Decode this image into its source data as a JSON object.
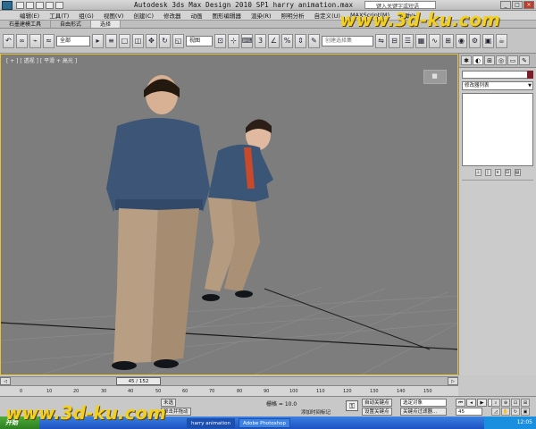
{
  "titlebar": {
    "title": "Autodesk 3ds Max Design 2010 SP1    harry animation.max",
    "search_placeholder": "键入关键字或短语"
  },
  "menubar": {
    "items": [
      "编辑(E)",
      "工具(T)",
      "组(G)",
      "视图(V)",
      "创建(C)",
      "修改器",
      "动画",
      "图形编辑器",
      "渲染(R)",
      "照明分析",
      "自定义(U)",
      "MAXScript(M)",
      "帮助(H)"
    ]
  },
  "ribbon": {
    "tabs": [
      "石墨建模工具",
      "自由形式",
      "选择"
    ]
  },
  "toolbar": {
    "selection_filter": "全部",
    "ref_coord": "视图",
    "named_selection": "创建选择集"
  },
  "viewport": {
    "label": "[ + ] [ 透视 ] [ 平滑 + 高光 ]"
  },
  "command_panel": {
    "modifier_list": "修改器列表"
  },
  "timeline": {
    "frame_display": "45 / 152",
    "ticks": [
      "0",
      "10",
      "20",
      "30",
      "40",
      "50",
      "60",
      "70",
      "80",
      "90",
      "100",
      "110",
      "120",
      "130",
      "140",
      "150"
    ]
  },
  "status": {
    "grid": "栅格 = 10.0",
    "auto_key": "自动关键点",
    "set_key": "设置关键点",
    "selected": "选定对象",
    "key_filters": "关键点过滤器...",
    "add_time_tag": "添加时间标记",
    "current_frame": "45",
    "selected_label": "未选",
    "click_hint": "单击并拖动"
  },
  "taskbar": {
    "start": "开始",
    "tasks": [
      "harry animation",
      "Adobe Photoshop"
    ],
    "clock": "12:05"
  },
  "watermark": {
    "text": "www.3d-ku.com"
  }
}
